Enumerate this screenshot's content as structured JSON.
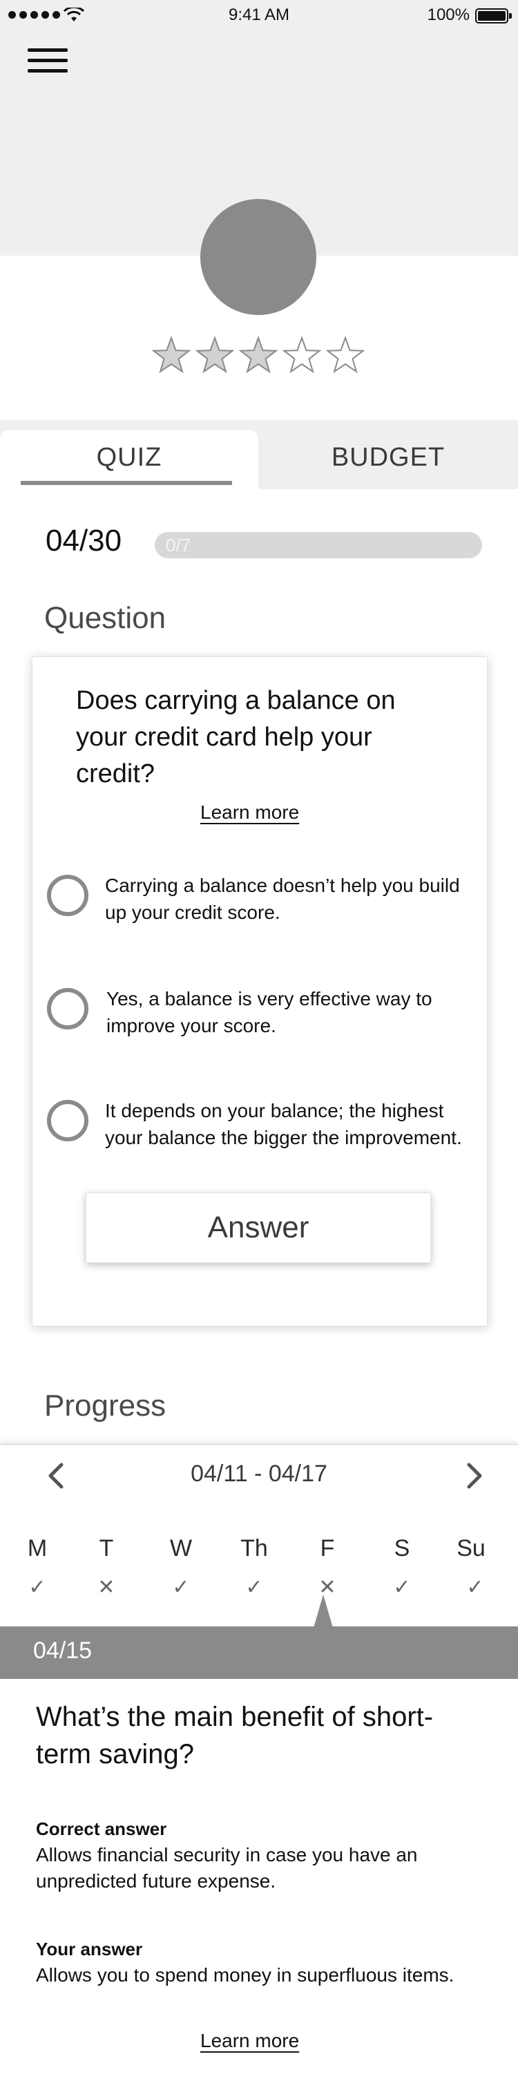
{
  "status_bar": {
    "time": "9:41 AM",
    "battery": "100%"
  },
  "header": {
    "menu_icon": "hamburger-menu-icon",
    "avatar": "avatar",
    "rating": {
      "value": 3,
      "max": 5
    }
  },
  "tabs": [
    {
      "label": "QUIZ",
      "active": true
    },
    {
      "label": "BUDGET",
      "active": false
    }
  ],
  "quiz": {
    "date": "04/30",
    "progress_text": "0/7",
    "progress_fraction": 0,
    "section_title": "Question",
    "question": "Does carrying a balance on your credit card help your credit?",
    "learn_more": "Learn more",
    "options": [
      "Carrying a balance doesn’t help you build up your credit score.",
      "Yes, a balance is very effective way to improve your score.",
      "It depends on your balance; the highest your balance the bigger the improvement."
    ],
    "answer_button": "Answer"
  },
  "progress": {
    "section_title": "Progress",
    "range": "04/11 - 04/17",
    "days": [
      {
        "label": "M",
        "result": "✓"
      },
      {
        "label": "T",
        "result": "✕"
      },
      {
        "label": "W",
        "result": "✓"
      },
      {
        "label": "Th",
        "result": "✓"
      },
      {
        "label": "F",
        "result": "✕"
      },
      {
        "label": "S",
        "result": "✓"
      },
      {
        "label": "Su",
        "result": "✓"
      }
    ],
    "selected_day": "F",
    "detail": {
      "date": "04/15",
      "question": "What’s the main benefit of short-term saving?",
      "correct_label": "Correct answer",
      "correct_text": "Allows financial security in case you have an unpredicted future expense.",
      "your_label": "Your answer",
      "your_text": "Allows you to spend money in superfluous items.",
      "learn_more": "Learn more"
    }
  },
  "colors": {
    "accent_gray": "#8a8a8a",
    "band_gray": "#efefef",
    "progress_track": "#d8d8d8"
  }
}
